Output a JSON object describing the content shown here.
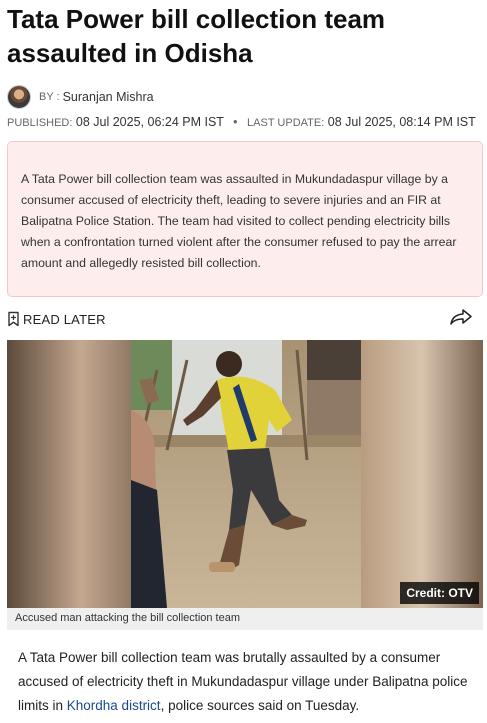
{
  "article": {
    "headline": "Tata Power bill collection team assaulted in Odisha",
    "byline_prefix": "BY :",
    "author": "Suranjan Mishra",
    "published_label": "PUBLISHED:",
    "published_date": "08 Jul 2025, 06:24 PM IST",
    "update_label": "LAST UPDATE:",
    "update_date": "08 Jul 2025, 08:14 PM IST",
    "summary": "A Tata Power bill collection team was assaulted in Mukundadaspur village by a consumer accused of electricity theft, leading to severe injuries and an FIR at Balipatna Police Station. The team had visited to collect pending electricity bills when a confrontation turned violent after the consumer refused to pay the arrear amount and allegedly resisted bill collection.",
    "read_later_label": "READ LATER",
    "image_credit": "Credit: OTV",
    "image_caption": "Accused man attacking the bill collection team",
    "body_before_link": "A Tata Power bill collection team was brutally assaulted by a consumer accused of electricity theft in Mukundadaspur village under Balipatna police limits in ",
    "body_link": "Khordha district",
    "body_after_link": ", police sources said on Tuesday."
  },
  "icons": {
    "avatar": "author-avatar",
    "bookmark": "bookmark-icon",
    "share": "share-icon"
  },
  "colors": {
    "summary_bg": "#fdeeed",
    "summary_border": "#f2c9c7",
    "link": "#1a4a8c"
  }
}
